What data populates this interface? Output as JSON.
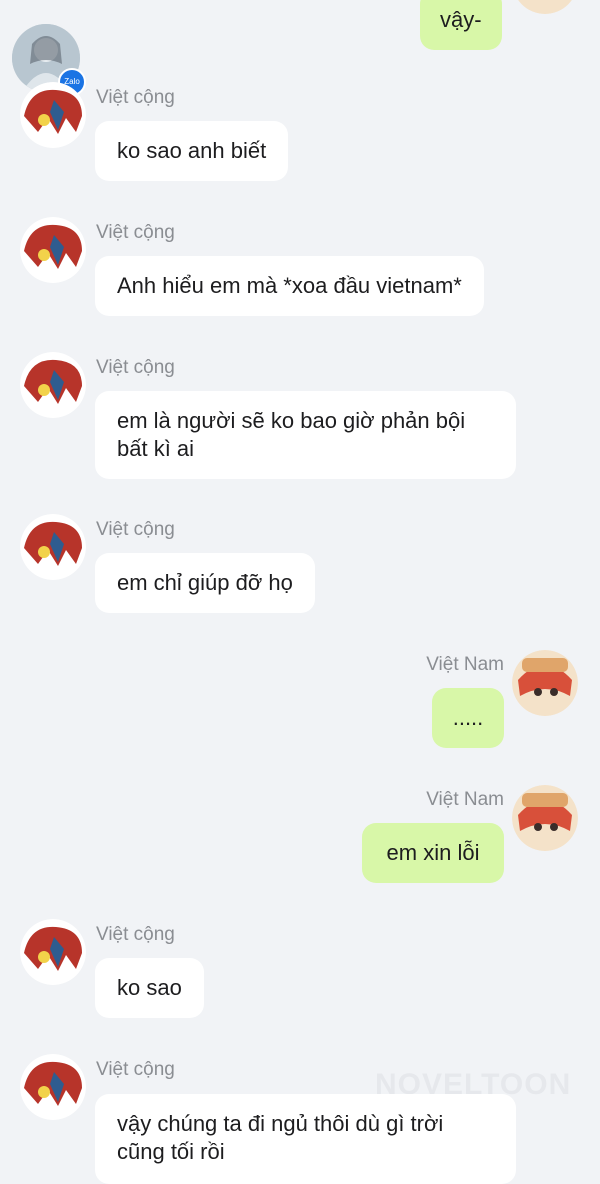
{
  "watermark": "NOVELTOON",
  "zalo_badge": "Zalo",
  "messages": [
    {
      "side": "out",
      "text": "vậy-"
    },
    {
      "side": "in",
      "sender": "Việt cộng",
      "text": "ko sao anh biết"
    },
    {
      "side": "in",
      "sender": "Việt cộng",
      "text": "Anh hiểu em mà *xoa đầu vietnam*"
    },
    {
      "side": "in",
      "sender": "Việt cộng",
      "text": "em là người sẽ ko bao giờ phản bội bất kì ai"
    },
    {
      "side": "in",
      "sender": "Việt cộng",
      "text": "em chỉ giúp đỡ họ"
    },
    {
      "side": "out",
      "sender": "Việt Nam",
      "text": "....."
    },
    {
      "side": "out",
      "sender": "Việt Nam",
      "text": "em xin lỗi"
    },
    {
      "side": "in",
      "sender": "Việt cộng",
      "text": "ko sao"
    },
    {
      "side": "in",
      "sender": "Việt cộng",
      "text": "vậy chúng ta đi ngủ thôi dù gì trời cũng tối rồi"
    }
  ],
  "colors": {
    "background": "#f1f3f6",
    "incoming_bubble": "#ffffff",
    "outgoing_bubble": "#d8f7a8",
    "sender_name": "#8a8d92"
  }
}
